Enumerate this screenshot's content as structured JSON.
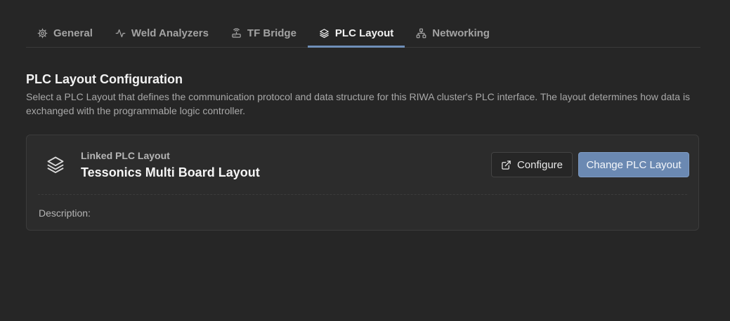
{
  "tabs": [
    {
      "label": "General",
      "icon": "gear-icon",
      "active": false
    },
    {
      "label": "Weld Analyzers",
      "icon": "activity-icon",
      "active": false
    },
    {
      "label": "TF Bridge",
      "icon": "router-icon",
      "active": false
    },
    {
      "label": "PLC Layout",
      "icon": "layers-icon",
      "active": true
    },
    {
      "label": "Networking",
      "icon": "network-icon",
      "active": false
    }
  ],
  "section": {
    "title": "PLC Layout Configuration",
    "description": "Select a PLC Layout that defines the communication protocol and data structure for this RIWA cluster's PLC interface. The layout determines how data is exchanged with the programmable logic controller."
  },
  "card": {
    "label": "Linked PLC Layout",
    "name": "Tessonics Multi Board Layout",
    "configure_label": "Configure",
    "change_label": "Change PLC Layout",
    "description_label": "Description:"
  },
  "colors": {
    "background": "#262626",
    "accent": "#6f8fb8",
    "primary_button": "#6b89b2"
  }
}
